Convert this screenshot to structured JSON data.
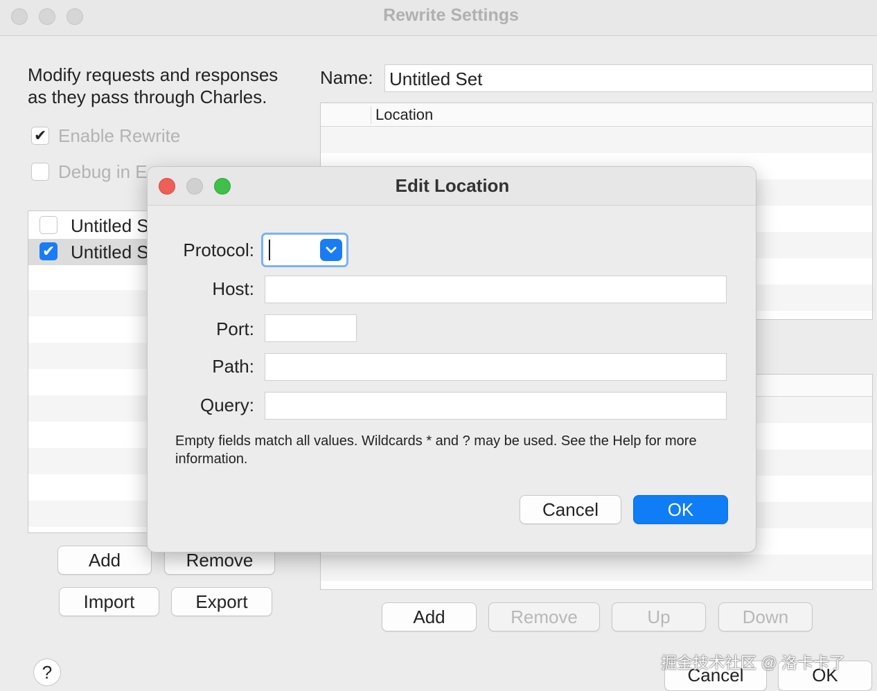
{
  "window": {
    "title": "Rewrite Settings"
  },
  "description": [
    "Modify requests and responses",
    "as they pass through Charles."
  ],
  "options": {
    "enable_rewrite": "Enable Rewrite",
    "debug": "Debug in E"
  },
  "sets": [
    {
      "label": "Untitled S",
      "checked": false
    },
    {
      "label": "Untitled S",
      "checked": true
    }
  ],
  "left_buttons": {
    "add": "Add",
    "remove": "Remove",
    "import": "Import",
    "export": "Export"
  },
  "help": "?",
  "name": {
    "label": "Name:",
    "value": "Untitled Set"
  },
  "locations_table": {
    "column": "Location"
  },
  "rules_buttons": {
    "add": "Add",
    "remove": "Remove",
    "up": "Up",
    "down": "Down"
  },
  "footer": {
    "cancel": "Cancel",
    "ok": "OK"
  },
  "watermark": "掘金技术社区 @ 洛卡卡了",
  "dialog": {
    "title": "Edit Location",
    "protocol_label": "Protocol:",
    "host_label": "Host:",
    "port_label": "Port:",
    "path_label": "Path:",
    "query_label": "Query:",
    "note": "Empty fields match all values. Wildcards * and ? may be used. See the Help for more information.",
    "cancel": "Cancel",
    "ok": "OK"
  },
  "colors": {
    "accent": "#0f7df5",
    "close": "#ee5f57",
    "minimize": "#d0d0d0",
    "zoom": "#3ec04a"
  }
}
